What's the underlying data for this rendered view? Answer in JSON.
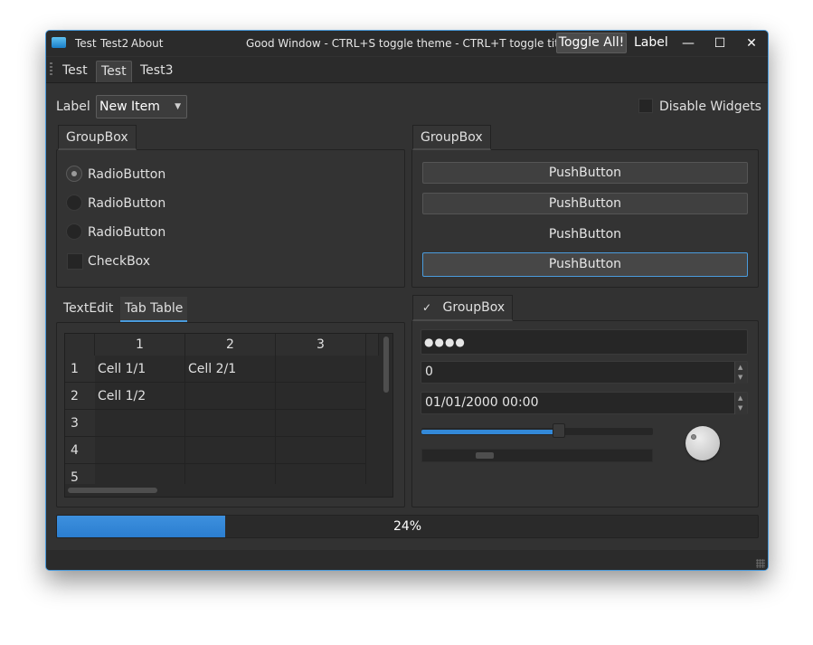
{
  "titlebar": {
    "menus": [
      "Test",
      "Test2",
      "About"
    ],
    "title": "Good Window - CTRL+S toggle theme - CTRL+T toggle title bar!",
    "toggle_all": "Toggle All!",
    "label": "Label",
    "minimize_glyph": "—",
    "maximize_glyph": "☐",
    "close_glyph": "✕"
  },
  "toolbar_tabs": [
    {
      "label": "Test",
      "selected": false
    },
    {
      "label": "Test",
      "selected": true
    },
    {
      "label": "Test3",
      "selected": false
    }
  ],
  "top_row": {
    "label": "Label",
    "combo_value": "New Item",
    "disable_widgets": "Disable Widgets",
    "disable_checked": false
  },
  "left_group": {
    "title": "GroupBox",
    "radios": [
      {
        "label": "RadioButton",
        "checked": true
      },
      {
        "label": "RadioButton",
        "checked": false
      },
      {
        "label": "RadioButton",
        "checked": false
      }
    ],
    "checkbox": {
      "label": "CheckBox",
      "checked": false
    }
  },
  "right_group": {
    "title": "GroupBox",
    "buttons": [
      "PushButton",
      "PushButton",
      "PushButton",
      "PushButton"
    ]
  },
  "tab_widget": {
    "tabs": [
      {
        "label": "TextEdit",
        "selected": false
      },
      {
        "label": "Tab Table",
        "selected": true
      }
    ],
    "table": {
      "columns": [
        "1",
        "2",
        "3"
      ],
      "rows": [
        {
          "header": "1",
          "cells": [
            "Cell 1/1",
            "Cell 2/1",
            ""
          ]
        },
        {
          "header": "2",
          "cells": [
            "Cell 1/2",
            "",
            ""
          ]
        },
        {
          "header": "3",
          "cells": [
            "",
            "",
            ""
          ]
        },
        {
          "header": "4",
          "cells": [
            "",
            "",
            ""
          ]
        },
        {
          "header": "5",
          "cells": [
            "",
            "",
            ""
          ]
        }
      ]
    }
  },
  "checkable_group": {
    "title": "GroupBox",
    "check_glyph": "✓",
    "password": "●●●●",
    "spin_value": "0",
    "datetime": "01/01/2000 00:00",
    "slider_fraction": 0.6,
    "scroll_fraction": 0.25
  },
  "progress": {
    "value": 24,
    "text": "24%"
  },
  "colors": {
    "accent": "#4a9bdc",
    "progress": "#3389d8",
    "background": "#323232"
  }
}
